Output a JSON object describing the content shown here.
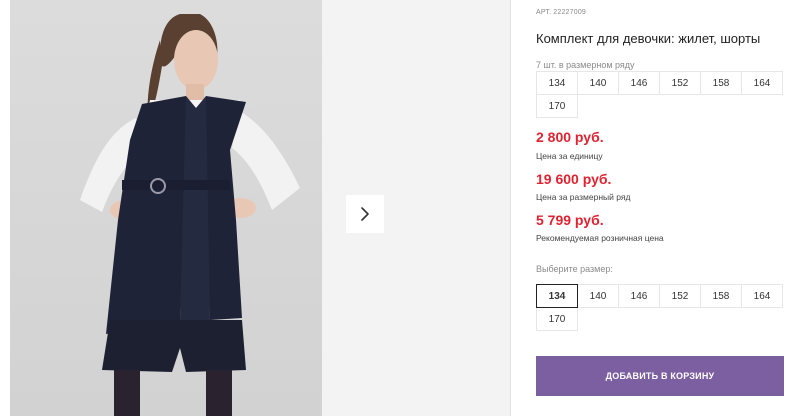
{
  "product": {
    "art_label": "АРТ.",
    "art_number": "22227009",
    "title": "Комплект для девочки: жилет, шорты"
  },
  "range": {
    "caption": "7 шт. в размерном ряду",
    "sizes": [
      "134",
      "140",
      "146",
      "152",
      "158",
      "164",
      "170"
    ]
  },
  "prices": [
    {
      "value": "2 800 руб.",
      "label": "Цена за единицу"
    },
    {
      "value": "19 600 руб.",
      "label": "Цена за размерный ряд"
    },
    {
      "value": "5 799 руб.",
      "label": "Рекомендуемая розничная цена"
    }
  ],
  "select": {
    "caption": "Выберите размер:",
    "sizes": [
      "134",
      "140",
      "146",
      "152",
      "158",
      "164",
      "170"
    ],
    "selected": "134"
  },
  "cart_button": "ДОБАВИТЬ В КОРЗИНУ",
  "colors": {
    "price": "#e02330",
    "accent": "#7b5fa0"
  },
  "icons": {
    "next": "chevron-right-icon"
  }
}
